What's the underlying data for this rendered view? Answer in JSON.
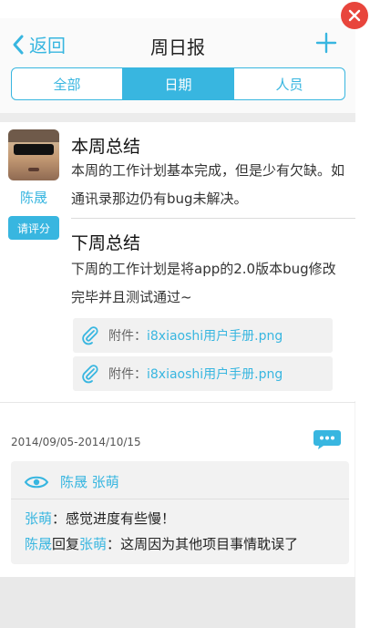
{
  "header": {
    "back_label": "返回",
    "title": "周日报",
    "tabs": [
      {
        "label": "全部",
        "active": false
      },
      {
        "label": "日期",
        "active": true
      },
      {
        "label": "人员",
        "active": false
      }
    ]
  },
  "report": {
    "author": "陈晟",
    "rate_label": "请评分",
    "this_week_title": "本周总结",
    "this_week_text": "本周的工作计划基本完成，但是少有欠缺。如通讯录那边仍有bug未解决。",
    "next_week_title": "下周总结",
    "next_week_text": "下周的工作计划是将app的2.0版本bug修改完毕并且测试通过~",
    "attachments": [
      {
        "label": "附件：",
        "file": "i8xiaoshi用户手册.png"
      },
      {
        "label": "附件：",
        "file": "i8xiaoshi用户手册.png"
      }
    ],
    "date_range": "2014/09/05-2014/10/15"
  },
  "comments": {
    "viewers": "陈晟  张萌",
    "lines": [
      {
        "name": "张萌",
        "sep": "：",
        "text": "感觉进度有些慢！"
      },
      {
        "name": "陈晟",
        "mid": "回复",
        "name2": "张萌",
        "sep": "：",
        "text": "这周因为其他项目事情耽误了"
      }
    ]
  },
  "colors": {
    "accent": "#38b6e0",
    "close": "#e8453c"
  },
  "icons": [
    "close-icon",
    "back-chevron-icon",
    "plus-icon",
    "paperclip-icon",
    "comment-bubble-icon",
    "eye-icon"
  ]
}
